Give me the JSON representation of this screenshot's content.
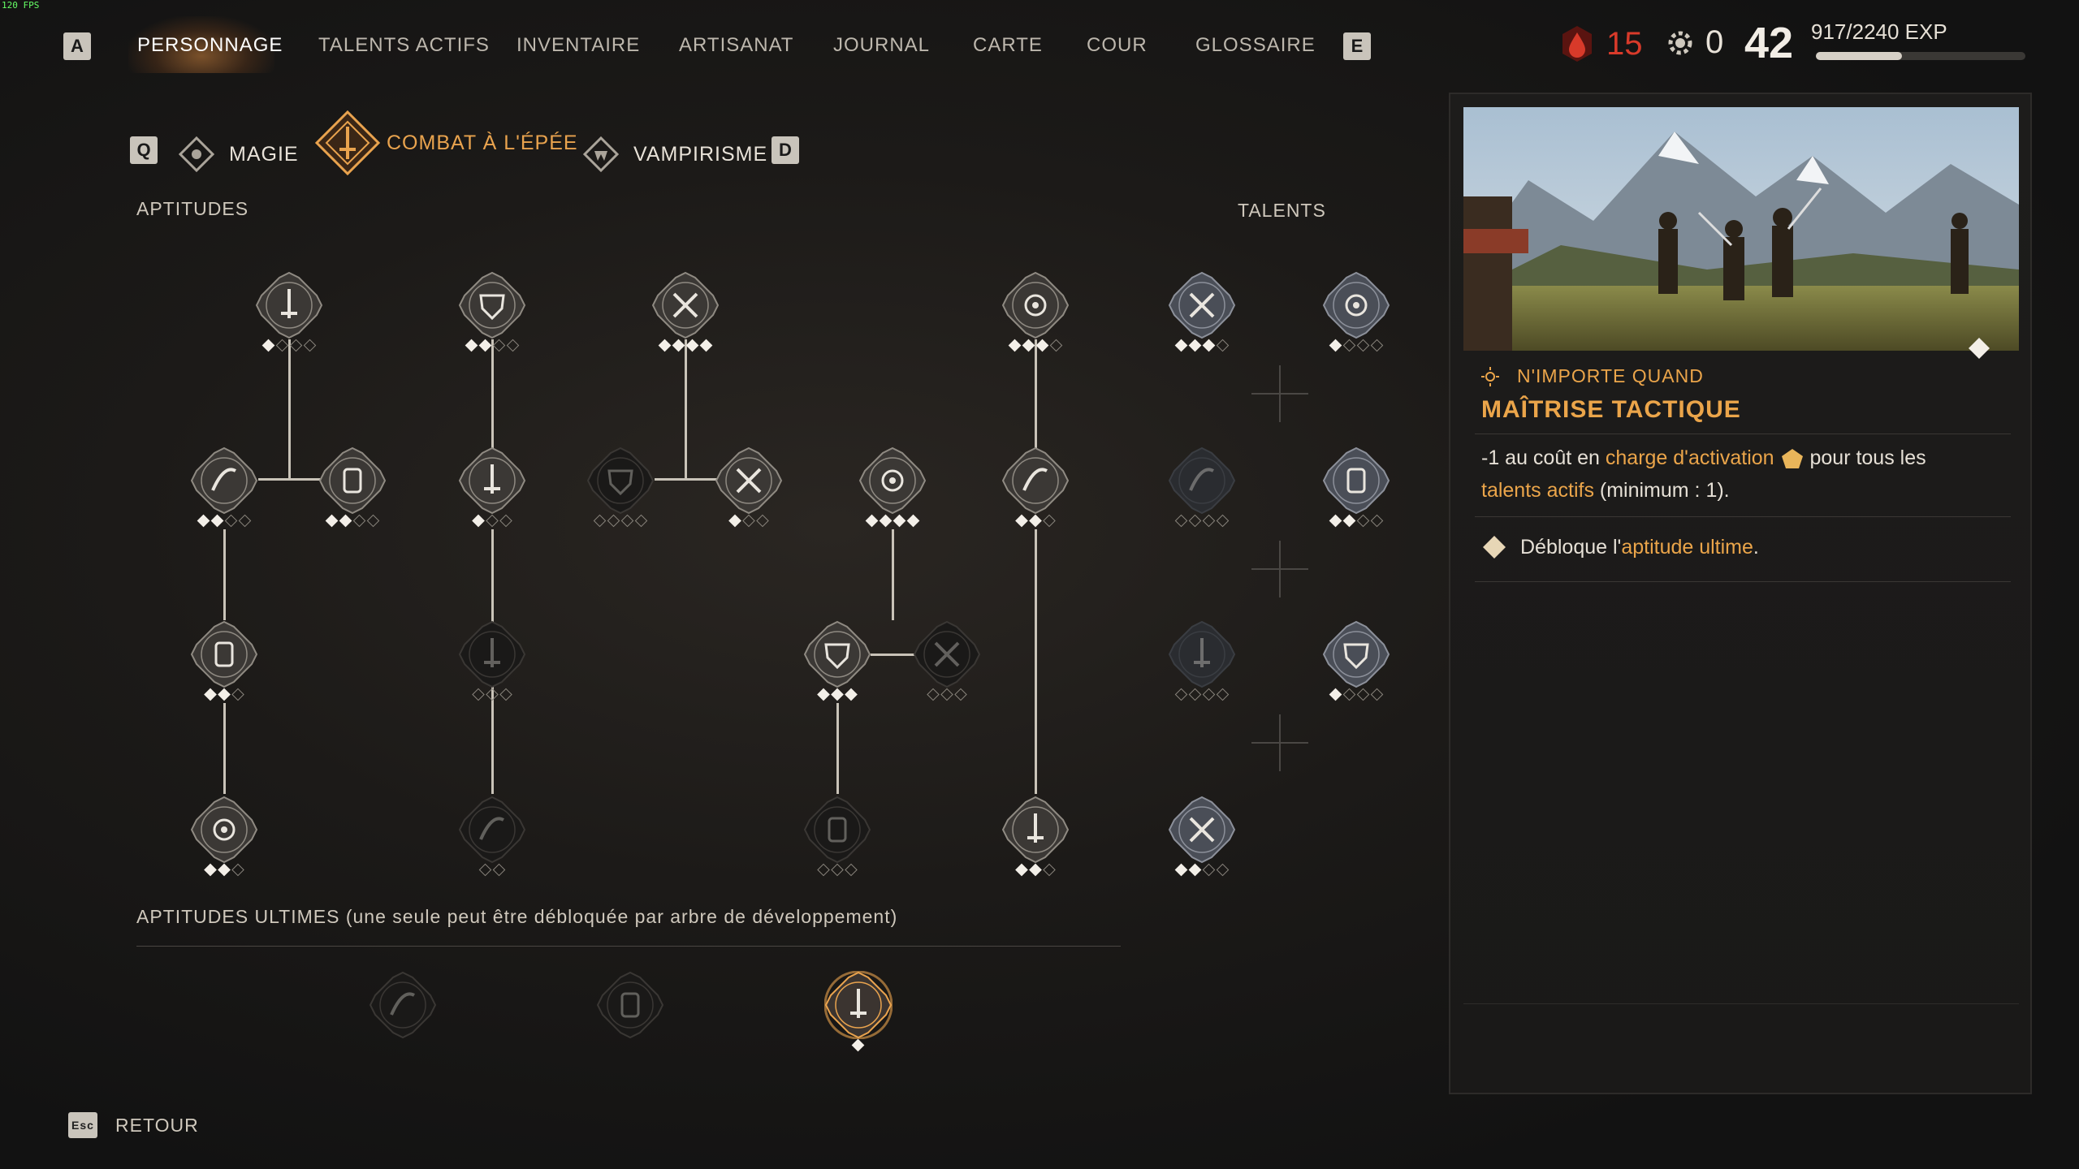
{
  "fps": "120 FPS",
  "nav": {
    "key_left": "A",
    "key_right": "E",
    "items": [
      "PERSONNAGE",
      "TALENTS ACTIFS",
      "INVENTAIRE",
      "ARTISANAT",
      "JOURNAL",
      "CARTE",
      "COUR",
      "GLOSSAIRE"
    ],
    "active": "PERSONNAGE"
  },
  "resources": {
    "blood_count": "15",
    "gear_count": "0",
    "level": "42",
    "exp_text": "917/2240 EXP",
    "exp_fraction": 0.41,
    "blood_color": "#d83a2a"
  },
  "subtabs": {
    "key_left": "Q",
    "key_right": "D",
    "items": [
      "MAGIE",
      "COMBAT À L'ÉPÉE",
      "VAMPIRISME"
    ],
    "active": "COMBAT À L'ÉPÉE",
    "active_color": "#e9a34e"
  },
  "sections": {
    "aptitudes": "APTITUDES",
    "talents": "TALENTS",
    "ultimate": "APTITUDES ULTIMES (une seule peut être débloquée par arbre de développement)"
  },
  "aptitudes": [
    {
      "icon": "shield-icon",
      "pips": [
        1,
        0,
        0,
        0
      ],
      "state": "unlocked"
    },
    {
      "icon": "sword-strike-icon",
      "pips": [
        1,
        1,
        0,
        0
      ],
      "state": "unlocked"
    },
    {
      "icon": "flexed-arm-icon",
      "pips": [
        1,
        1,
        1,
        1
      ],
      "state": "unlocked"
    },
    {
      "icon": "fist-icon",
      "pips": [
        1,
        1,
        1,
        0
      ],
      "state": "unlocked"
    },
    {
      "icon": "slash-icon",
      "pips": [
        1,
        1,
        0,
        0
      ],
      "state": "unlocked"
    },
    {
      "icon": "crossed-swords-icon",
      "pips": [
        1,
        1,
        0,
        0
      ],
      "state": "unlocked"
    },
    {
      "icon": "downward-sword-icon",
      "pips": [
        1,
        0,
        0
      ],
      "state": "unlocked"
    },
    {
      "icon": "dodge-icon",
      "pips": [
        0,
        0,
        0,
        0
      ],
      "state": "locked"
    },
    {
      "icon": "charge-icon",
      "pips": [
        1,
        0,
        0
      ],
      "state": "unlocked"
    },
    {
      "icon": "burst-icon",
      "pips": [
        1,
        1,
        1,
        1
      ],
      "state": "unlocked"
    },
    {
      "icon": "armor-icon",
      "pips": [
        1,
        1,
        0
      ],
      "state": "unlocked"
    },
    {
      "icon": "parry-icon",
      "pips": [
        1,
        1,
        0
      ],
      "state": "unlocked"
    },
    {
      "icon": "riposte-icon",
      "pips": [
        0,
        0,
        0
      ],
      "state": "locked"
    },
    {
      "icon": "sword-up-icon",
      "pips": [
        1,
        1,
        1
      ],
      "state": "unlocked"
    },
    {
      "icon": "target-icon",
      "pips": [
        0,
        0,
        0
      ],
      "state": "locked"
    },
    {
      "icon": "bullseye-icon",
      "pips": [
        1,
        1,
        0
      ],
      "state": "unlocked"
    },
    {
      "icon": "sword-pillar-icon",
      "pips": [
        0,
        0
      ],
      "state": "locked"
    },
    {
      "icon": "leap-icon",
      "pips": [
        0,
        0,
        0
      ],
      "state": "locked"
    },
    {
      "icon": "heavy-armor-icon",
      "pips": [
        1,
        1,
        0
      ],
      "state": "unlocked"
    }
  ],
  "talents": [
    {
      "icon": "claw-strike-icon",
      "pips": [
        1,
        1,
        1,
        0
      ],
      "state": "unlocked"
    },
    {
      "icon": "scythe-icon",
      "pips": [
        1,
        0,
        0,
        0
      ],
      "state": "unlocked"
    },
    {
      "icon": "wolf-icon",
      "pips": [
        0,
        0,
        0,
        0
      ],
      "state": "locked"
    },
    {
      "icon": "skull-icon",
      "pips": [
        1,
        1,
        0,
        0
      ],
      "state": "unlocked"
    },
    {
      "icon": "eye-icon",
      "pips": [
        0,
        0,
        0,
        0
      ],
      "state": "locked"
    },
    {
      "icon": "rune-icon",
      "pips": [
        1,
        0,
        0,
        0
      ],
      "state": "unlocked"
    },
    {
      "icon": "flow-icon",
      "pips": [
        1,
        1,
        0,
        0
      ],
      "state": "unlocked"
    }
  ],
  "ultimates": [
    {
      "icon": "clenched-fist-icon",
      "state": "locked"
    },
    {
      "icon": "sword-stance-icon",
      "state": "locked"
    },
    {
      "icon": "tactical-mastery-icon",
      "state": "selected"
    }
  ],
  "detail": {
    "timing": "N'IMPORTE QUAND",
    "title": "MAÎTRISE TACTIQUE",
    "desc_1": "-1 au coût en ",
    "desc_hl_1": "charge d'activation",
    "desc_2": " pour tous les",
    "desc_hl_2": "talents actifs",
    "desc_3": " (minimum : 1).",
    "unlock_1": "Débloque l'",
    "unlock_hl": "aptitude ultime",
    "unlock_2": "."
  },
  "back": {
    "key": "Esc",
    "label": "RETOUR"
  }
}
